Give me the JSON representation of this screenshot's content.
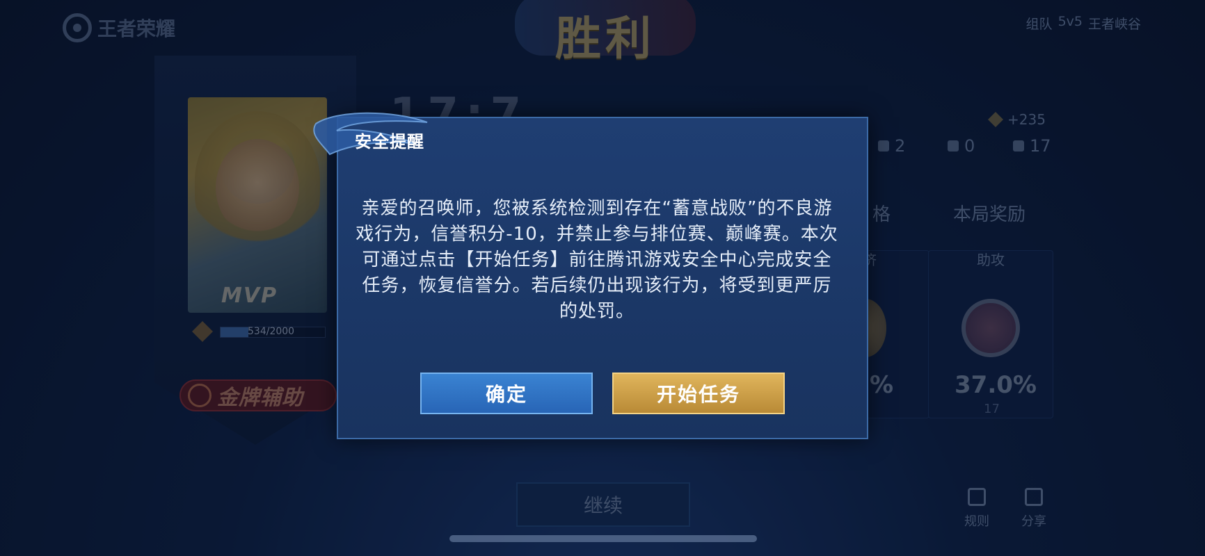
{
  "background": {
    "logo_text": "王者荣耀",
    "victory_text": "胜利",
    "mode": {
      "team": "组队",
      "size": "5v5",
      "map": "王者峡谷"
    },
    "score_text": "17:7",
    "stats": {
      "kills": "2",
      "deaths": "0",
      "assists": "17"
    },
    "points_gain": "+235",
    "mvp_label": "MVP",
    "xp_text": "534/2000",
    "xp_fraction": 0.267,
    "gold_badge": "金牌辅助",
    "col_performance": "格",
    "col_reward": "本局奖励",
    "card_label": "助攻",
    "card_left_label": "济",
    "assist_pct": "37.0%",
    "left_pct": "%",
    "assist_count": "17",
    "continue_label": "继续",
    "rule_label": "规则",
    "share_label": "分享"
  },
  "dialog": {
    "title": "安全提醒",
    "message": "亲爱的召唤师，您被系统检测到存在“蓄意战败”的不良游戏行为，信誉积分-10，并禁止参与排位赛、巅峰赛。本次可通过点击【开始任务】前往腾讯游戏安全中心完成安全任务，恢复信誉分。若后续仍出现该行为，将受到更严厉的处罚。",
    "confirm_label": "确定",
    "start_task_label": "开始任务"
  },
  "colors": {
    "confirm_button": "#2f6fc2",
    "task_button": "#cfa048",
    "dialog_bg": "#1d3a6c"
  }
}
